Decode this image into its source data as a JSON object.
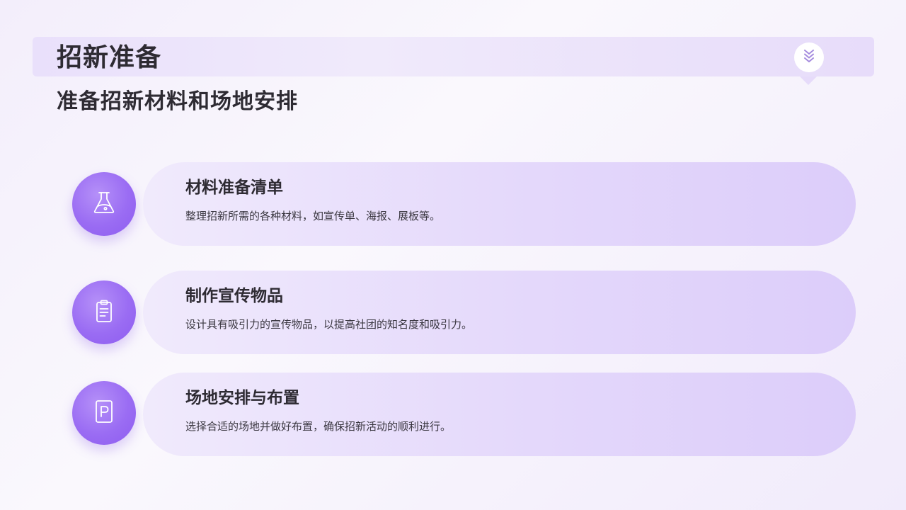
{
  "header": {
    "title": "招新准备",
    "badge_icon": "chevrons-down-icon"
  },
  "subtitle": "准备招新材料和场地安排",
  "colors": {
    "accent": "#9a6cf3",
    "header_bar": "#ebe3fb",
    "card": "#e6dbfb",
    "text": "#2e2b33"
  },
  "items": [
    {
      "icon": "flask-icon",
      "title": "材料准备清单",
      "description": "整理招新所需的各种材料，如宣传单、海报、展板等。"
    },
    {
      "icon": "clipboard-icon",
      "title": "制作宣传物品",
      "description": "设计具有吸引力的宣传物品，以提高社团的知名度和吸引力。"
    },
    {
      "icon": "parking-icon",
      "title": "场地安排与布置",
      "description": "选择合适的场地并做好布置，确保招新活动的顺利进行。"
    }
  ]
}
